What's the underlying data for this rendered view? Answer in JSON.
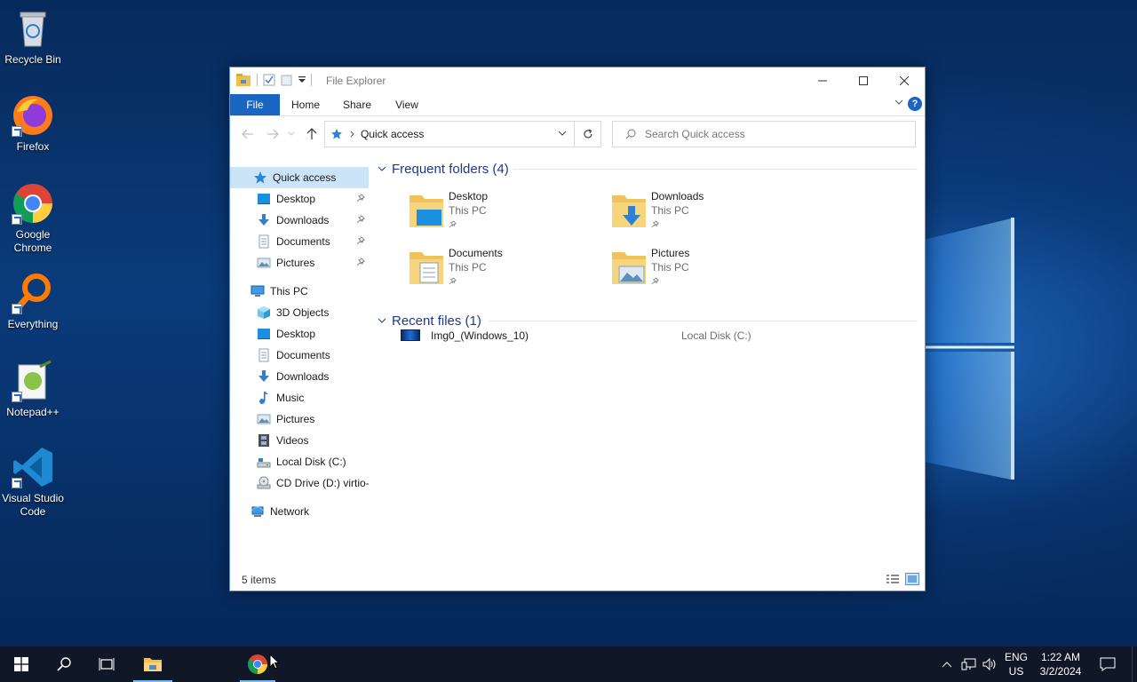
{
  "desktop": {
    "icons": [
      {
        "label": "Recycle Bin"
      },
      {
        "label": "Firefox"
      },
      {
        "label": "Google Chrome"
      },
      {
        "label": "Everything"
      },
      {
        "label": "Notepad++"
      },
      {
        "label": "Visual Studio Code"
      }
    ]
  },
  "explorer": {
    "title": "File Explorer",
    "ribbon_tabs": [
      "File",
      "Home",
      "Share",
      "View"
    ],
    "help": "?",
    "address": {
      "crumb": "Quick access"
    },
    "search": {
      "placeholder": "Search Quick access"
    },
    "nav": {
      "quick_access": "Quick access",
      "quick_items": [
        "Desktop",
        "Downloads",
        "Documents",
        "Pictures"
      ],
      "this_pc": "This PC",
      "pc_items": [
        "3D Objects",
        "Desktop",
        "Documents",
        "Downloads",
        "Music",
        "Pictures",
        "Videos",
        "Local Disk (C:)",
        "CD Drive (D:) virtio-"
      ],
      "network": "Network"
    },
    "frequent": {
      "heading": "Frequent folders (4)",
      "folders": [
        {
          "name": "Desktop",
          "location": "This PC"
        },
        {
          "name": "Downloads",
          "location": "This PC"
        },
        {
          "name": "Documents",
          "location": "This PC"
        },
        {
          "name": "Pictures",
          "location": "This PC"
        }
      ]
    },
    "recent": {
      "heading": "Recent files (1)",
      "files": [
        {
          "name": "Img0_(Windows_10)",
          "location": "Local Disk (C:)"
        }
      ]
    },
    "status": {
      "count": "5 items"
    }
  },
  "taskbar": {
    "lang": "ENG",
    "region": "US",
    "time": "1:22 AM",
    "date": "3/2/2024"
  },
  "colors": {
    "accent": "#1a64c2",
    "selection": "#cce4f7",
    "taskbar": "#101726",
    "heading": "#1e3a8a"
  }
}
